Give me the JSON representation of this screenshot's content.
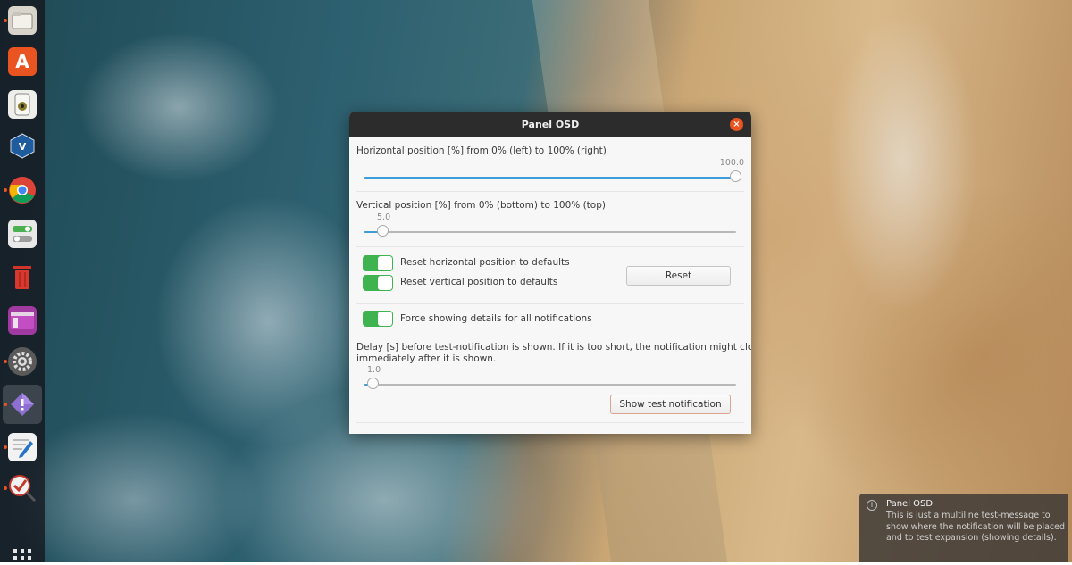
{
  "dialog": {
    "title": "Panel OSD",
    "horizontal": {
      "label": "Horizontal position [%] from 0% (left) to 100% (right)",
      "value_text": "100.0",
      "value_percent": 100
    },
    "vertical": {
      "label": "Vertical position [%] from 0% (bottom) to 100% (top)",
      "value_text": "5.0",
      "value_percent": 5
    },
    "reset_horizontal_label": "Reset horizontal position to defaults",
    "reset_vertical_label": "Reset vertical position to defaults",
    "reset_button": "Reset",
    "force_details_label": "Force showing details for all notifications",
    "delay": {
      "label_line1": "Delay [s] before test-notification is shown. If it is too short, the notification might close",
      "label_line2": "immediately after it is shown.",
      "value_text": "1.0",
      "value_fraction": 0.025
    },
    "show_test_button": "Show test notification"
  },
  "notification": {
    "title": "Panel OSD",
    "body": "This is just a multiline test-message to show where the notification will be placed and to test expansion (showing details)."
  },
  "dock": {
    "items": [
      "files-icon",
      "software-icon",
      "speaker-icon",
      "virtualbox-icon",
      "chrome-icon",
      "toggle-settings-icon",
      "trash-icon",
      "window-app-icon",
      "settings-icon",
      "extension-icon",
      "text-editor-icon",
      "checkbox-app-icon"
    ],
    "show_apps_icon": "grid-icon"
  },
  "colors": {
    "accent": "#e95420",
    "switch_on": "#3eb34f",
    "slider_fill": "#3d9dda"
  }
}
